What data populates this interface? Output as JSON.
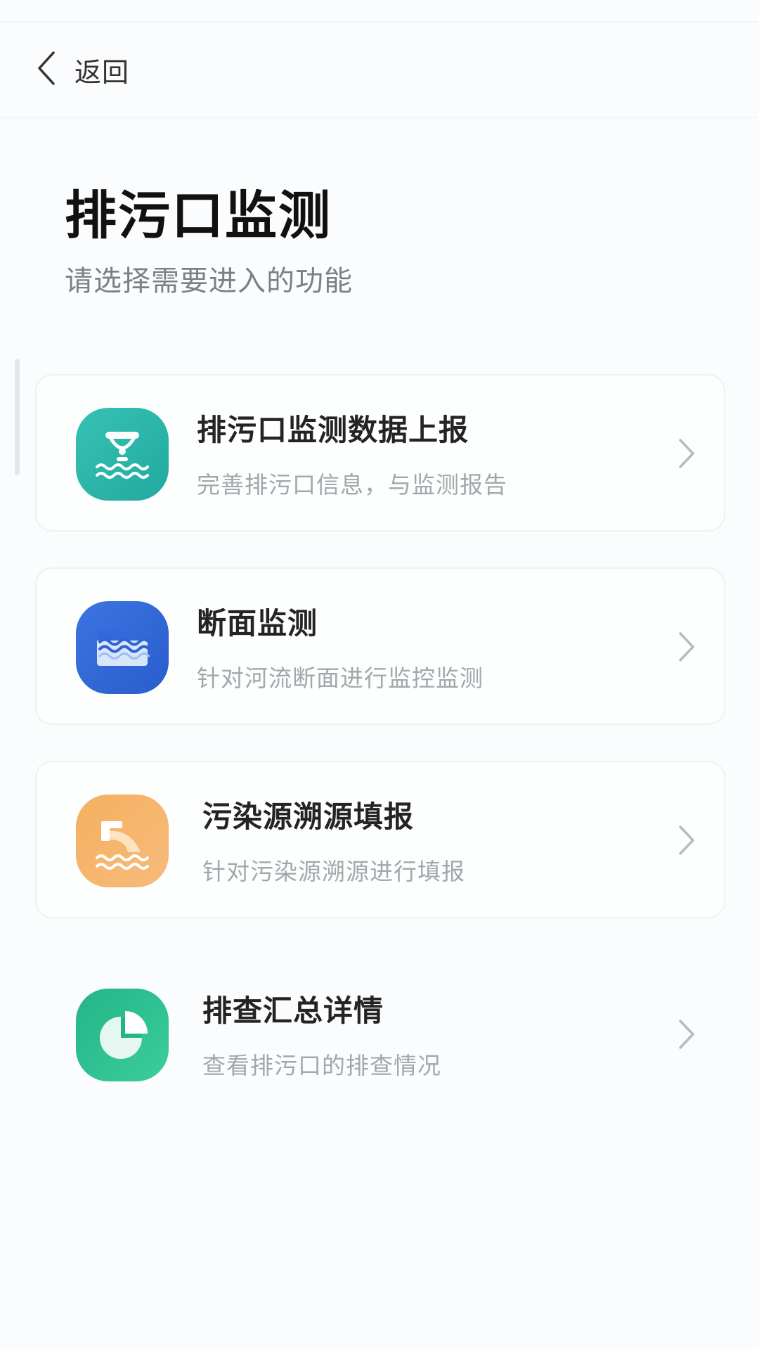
{
  "header": {
    "back_label": "返回"
  },
  "page": {
    "title": "排污口监测",
    "subtitle": "请选择需要进入的功能"
  },
  "menu": {
    "items": [
      {
        "title": "排污口监测数据上报",
        "description": "完善排污口信息，与监测报告",
        "icon": "outfall-water-icon",
        "color": "#2db5aa"
      },
      {
        "title": "断面监测",
        "description": "针对河流断面进行监控监测",
        "icon": "river-section-icon",
        "color": "#3468d8"
      },
      {
        "title": "污染源溯源填报",
        "description": "针对污染源溯源进行填报",
        "icon": "pipe-discharge-icon",
        "color": "#f2a552"
      },
      {
        "title": "排查汇总详情",
        "description": "查看排污口的排查情况",
        "icon": "pie-chart-icon",
        "color": "#28bd8c"
      }
    ]
  }
}
